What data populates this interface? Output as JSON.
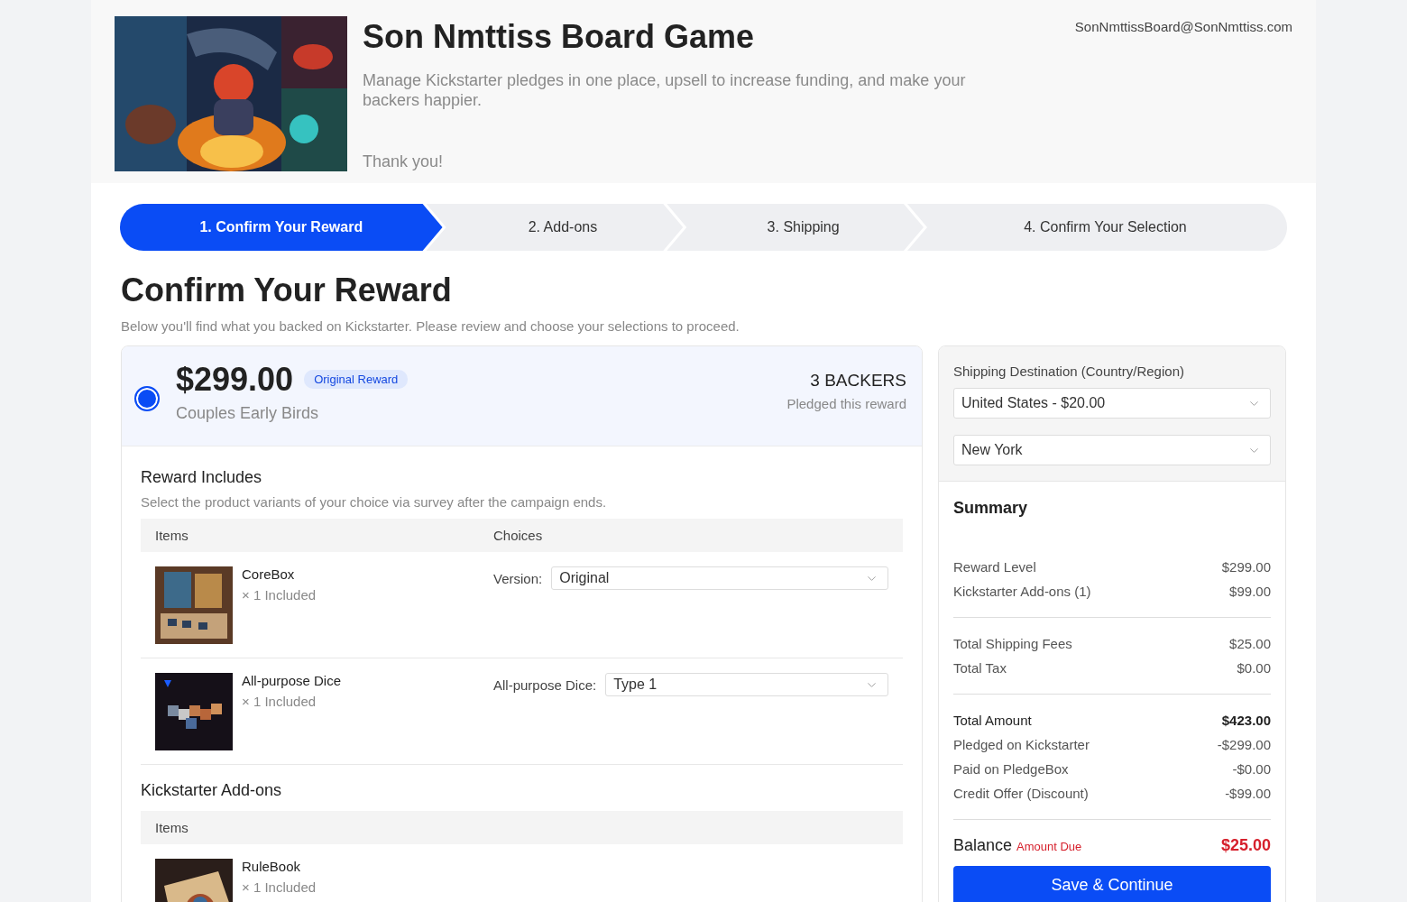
{
  "header": {
    "title": "Son Nmttiss Board Game",
    "email": "SonNmttissBoard@SonNmttiss.com",
    "description": "Manage Kickstarter pledges in one place, upsell to increase funding, and make your backers happier.",
    "thank_you": "Thank you!"
  },
  "steps": [
    {
      "label": "1. Confirm Your Reward",
      "selected": true
    },
    {
      "label": "2. Add-ons",
      "selected": false
    },
    {
      "label": "3. Shipping",
      "selected": false
    },
    {
      "label": "4. Confirm Your Selection",
      "selected": false
    }
  ],
  "page": {
    "title": "Confirm Your Reward",
    "subtitle": "Below you'll find what you backed on Kickstarter. Please review and choose your selections to proceed."
  },
  "reward": {
    "selected": true,
    "price": "$299.00",
    "badge": "Original Reward",
    "name": "Couples Early Birds",
    "backers": "3 BACKERS",
    "backers_note": "Pledged this reward"
  },
  "includes": {
    "title": "Reward Includes",
    "note": "Select the product variants of your choice via survey after the campaign ends.",
    "columns": [
      "Items",
      "Choices"
    ],
    "items": [
      {
        "name": "CoreBox",
        "qty": "× 1 Included",
        "choice_label": "Version:",
        "choice_value": "Original"
      },
      {
        "name": "All-purpose Dice",
        "qty": "× 1 Included",
        "choice_label": "All-purpose Dice:",
        "choice_value": "Type 1"
      }
    ]
  },
  "addons": {
    "title": "Kickstarter Add-ons",
    "columns": [
      "Items"
    ],
    "items": [
      {
        "name": "RuleBook",
        "qty": "× 1 Included"
      }
    ]
  },
  "shipping": {
    "label": "Shipping Destination (Country/Region)",
    "country": "United States - $20.00",
    "region": "New York"
  },
  "summary": {
    "title": "Summary",
    "groups": [
      [
        {
          "label": "Reward Level",
          "value": "$299.00",
          "kind": "line"
        },
        {
          "label": "Kickstarter Add-ons (1)",
          "value": "$99.00",
          "kind": "line"
        }
      ],
      [
        {
          "label": "Total Shipping Fees",
          "value": "$25.00",
          "kind": "line"
        },
        {
          "label": "Total Tax",
          "value": "$0.00",
          "kind": "line"
        }
      ],
      [
        {
          "label": "Total Amount",
          "value": "$423.00",
          "kind": "total"
        },
        {
          "label": "Pledged on Kickstarter",
          "value": "-$299.00",
          "kind": "line"
        },
        {
          "label": "Paid on PledgeBox",
          "value": "-$0.00",
          "kind": "line"
        },
        {
          "label": "Credit Offer (Discount)",
          "value": "-$99.00",
          "kind": "line"
        }
      ]
    ],
    "balance": {
      "label": "Balance",
      "note": "Amount Due",
      "value": "$25.00"
    },
    "button": "Save & Continue"
  }
}
